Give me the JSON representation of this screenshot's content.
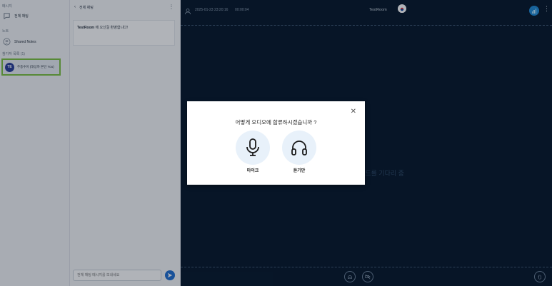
{
  "sidebar": {
    "section_messages": "메시지",
    "public_chat": "전체 채팅",
    "section_notes": "노트",
    "shared_notes": "Shared Notes",
    "section_users": "참가자 목록 (1)",
    "user": {
      "initials": "TE",
      "name": "주종수이 (대상자 본인 You)"
    }
  },
  "chat": {
    "header": "전체 채팅",
    "welcome_bold": "TestRoom",
    "welcome_rest": "에 오신걸 환영합니다!",
    "input_placeholder": "전체 채팅 메시지를 보내세요"
  },
  "topbar": {
    "date": "2025-01-23 23:20:16",
    "timer": "00:00:04",
    "room": "TestRoom"
  },
  "stage": {
    "waiting_text": "로드를 기다리 중"
  },
  "modal": {
    "title": "어떻게 오디오에 합류하시겠습니까 ?",
    "mic_label": "마이크",
    "listen_label": "듣기만"
  },
  "colors": {
    "accent": "#1f6fd1",
    "highlight_border": "#7cc242",
    "background": "#06172a"
  }
}
